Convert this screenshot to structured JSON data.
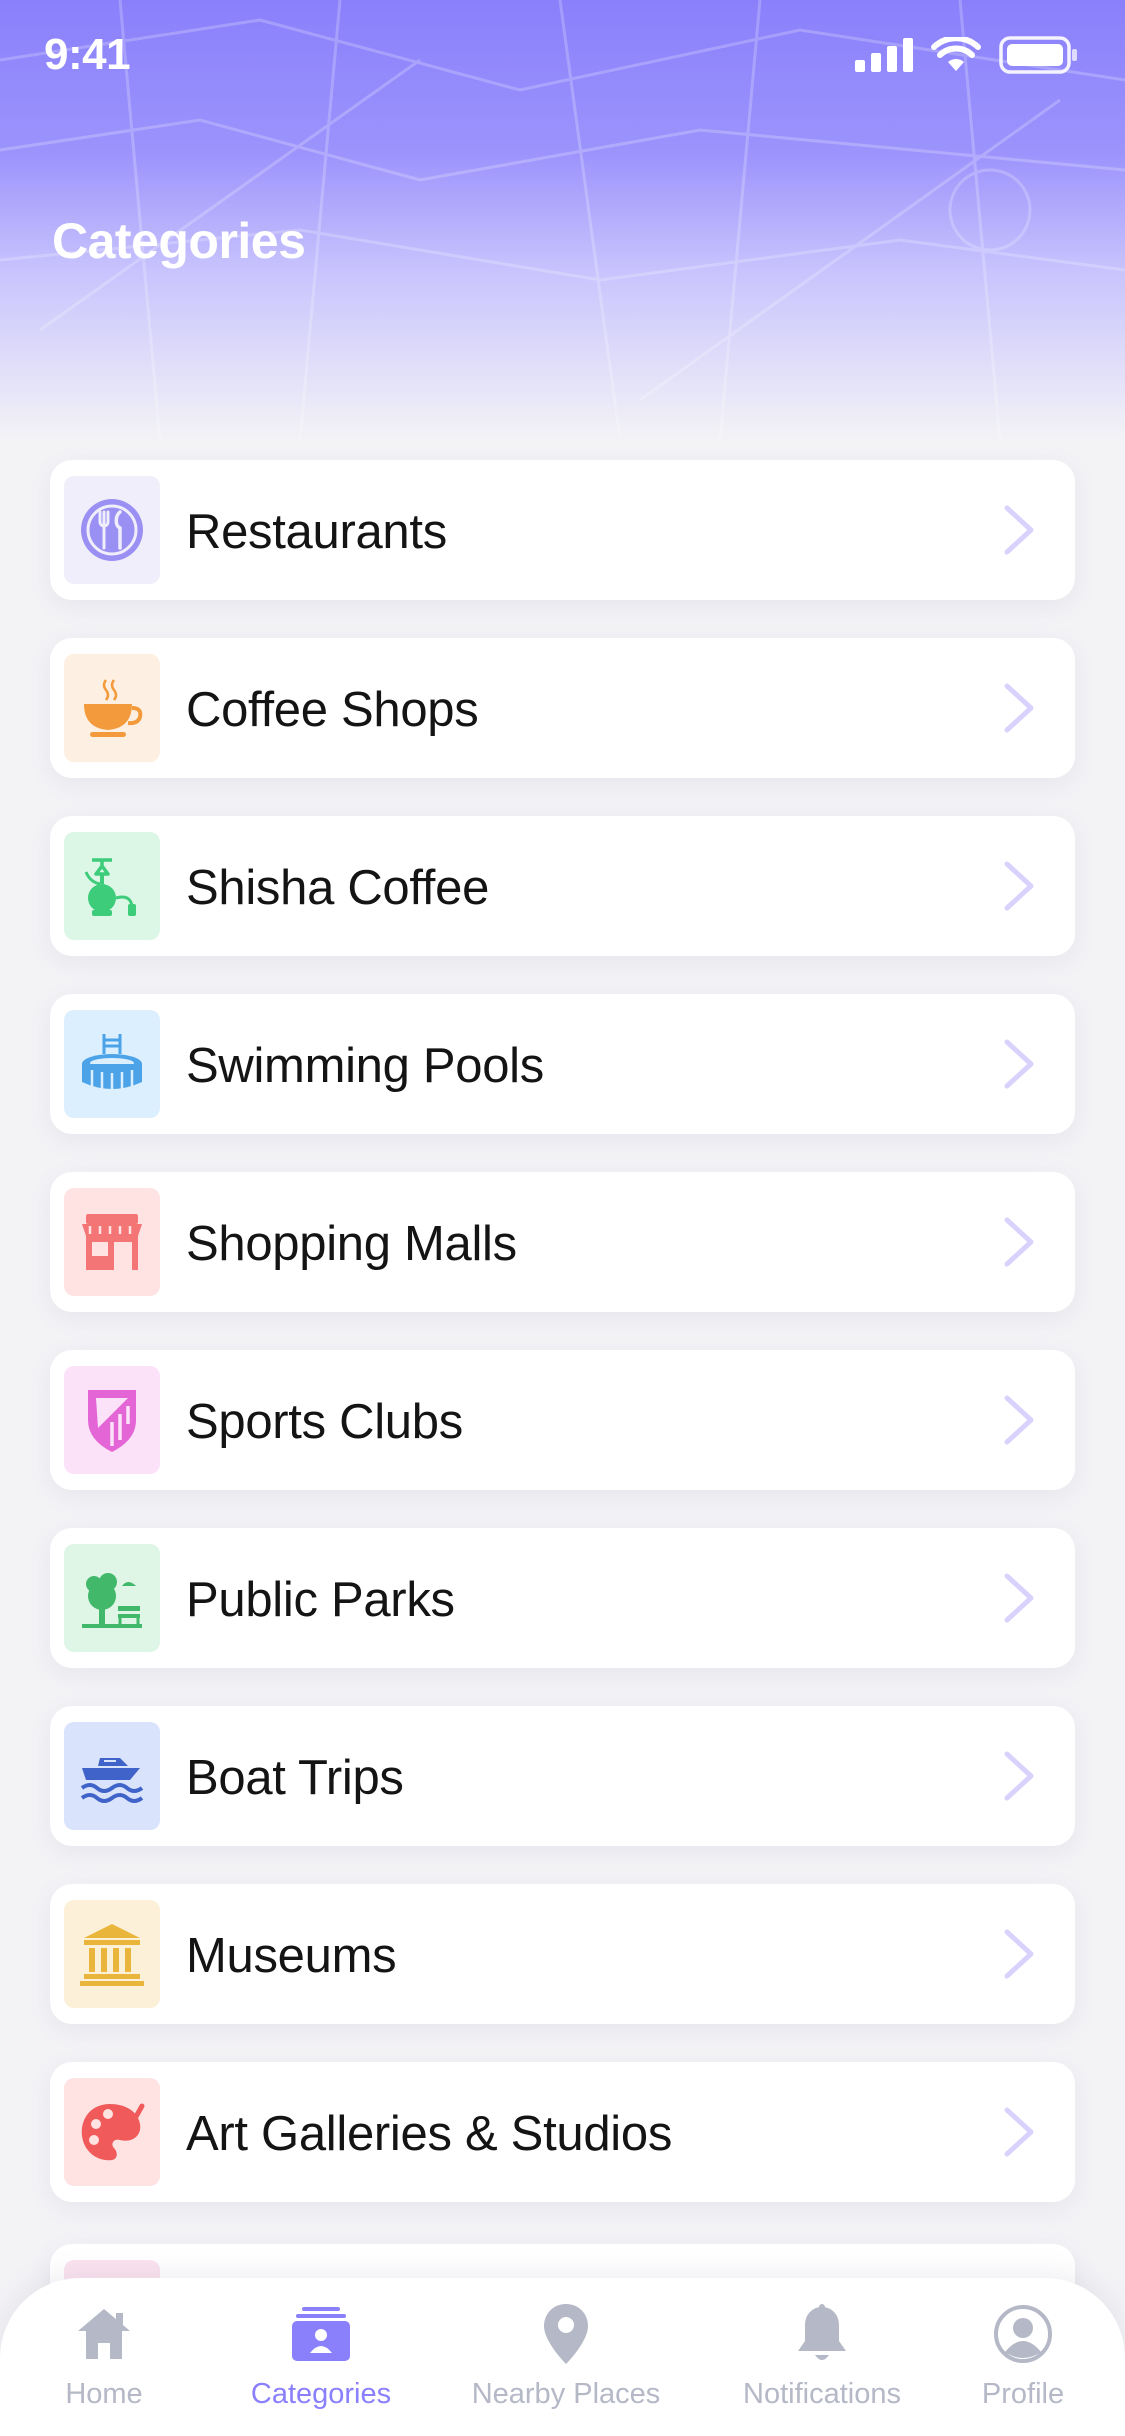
{
  "status_bar": {
    "time": "9:41"
  },
  "page": {
    "title": "Categories"
  },
  "categories": [
    {
      "label": "Restaurants",
      "icon": "restaurant-icon",
      "tile_color": "#efeefa",
      "icon_color": "#9a8ff2"
    },
    {
      "label": "Coffee Shops",
      "icon": "coffee-cup-icon",
      "tile_color": "#fdf0e2",
      "icon_color": "#f29a3c"
    },
    {
      "label": "Shisha Coffee",
      "icon": "shisha-icon",
      "tile_color": "#ddf7e7",
      "icon_color": "#3ccc7a"
    },
    {
      "label": "Swimming Pools",
      "icon": "pool-icon",
      "tile_color": "#dcefff",
      "icon_color": "#4da3e8"
    },
    {
      "label": "Shopping Malls",
      "icon": "shop-icon",
      "tile_color": "#ffe3e3",
      "icon_color": "#f47576"
    },
    {
      "label": "Sports Clubs",
      "icon": "sports-club-icon",
      "tile_color": "#fbe2f8",
      "icon_color": "#e466d6"
    },
    {
      "label": "Public Parks",
      "icon": "park-icon",
      "tile_color": "#dff6e6",
      "icon_color": "#42b96a"
    },
    {
      "label": "Boat Trips",
      "icon": "boat-icon",
      "tile_color": "#d9e3fb",
      "icon_color": "#3f63c9"
    },
    {
      "label": "Museums",
      "icon": "museum-icon",
      "tile_color": "#fdf0d8",
      "icon_color": "#eab53b"
    },
    {
      "label": "Art Galleries & Studios",
      "icon": "palette-icon",
      "tile_color": "#ffe3e3",
      "icon_color": "#f05a5a"
    }
  ],
  "tabbar": {
    "items": [
      {
        "label": "Home",
        "icon": "home-icon",
        "active": false
      },
      {
        "label": "Categories",
        "icon": "categories-icon",
        "active": true
      },
      {
        "label": "Nearby Places",
        "icon": "location-pin-icon",
        "active": false
      },
      {
        "label": "Notifications",
        "icon": "bell-icon",
        "active": false
      },
      {
        "label": "Profile",
        "icon": "profile-icon",
        "active": false
      }
    ],
    "active_color": "#8a80fb",
    "inactive_color": "#b5b8c6"
  }
}
